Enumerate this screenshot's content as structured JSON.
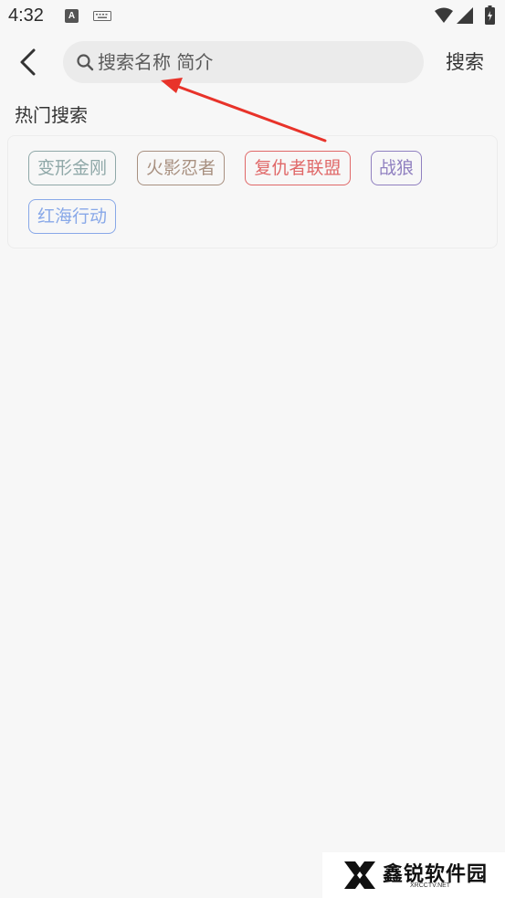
{
  "status_bar": {
    "time": "4:32",
    "icons": [
      "a-notification-icon",
      "keyboard-icon",
      "wifi-icon",
      "signal-icon",
      "battery-icon"
    ]
  },
  "header": {
    "back_icon": "chevron-left-icon",
    "search": {
      "placeholder": "搜索名称 简介",
      "value": ""
    },
    "search_button_label": "搜索"
  },
  "hot_search": {
    "title": "热门搜索",
    "tags": [
      {
        "label": "变形金刚",
        "color": "#8fa8a8"
      },
      {
        "label": "火影忍者",
        "color": "#a89080"
      },
      {
        "label": "复仇者联盟",
        "color": "#e06868"
      },
      {
        "label": "战狼",
        "color": "#9080c0"
      },
      {
        "label": "红海行动",
        "color": "#88a8e8"
      }
    ]
  },
  "annotation": {
    "color": "#e8332a"
  },
  "watermark": {
    "name": "鑫锐软件园",
    "site": "XRCCTV.NET"
  }
}
